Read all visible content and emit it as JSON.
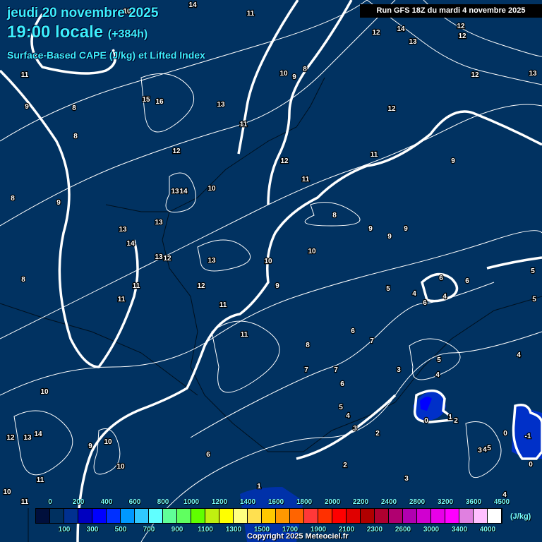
{
  "header": {
    "date": "jeudi 20 novembre 2025",
    "time": "19:00 locale",
    "offset": "(+384h)",
    "parameter": "Surface-Based CAPE (J/kg) et Lifted Index",
    "run": "Run GFS 18Z du mardi 4 novembre 2025"
  },
  "map": {
    "background_color": "#013261",
    "contour_labels": [
      "10",
      "14",
      "11",
      "12",
      "14",
      "12",
      "12",
      "13",
      "11",
      "10",
      "9",
      "8",
      "12",
      "13",
      "9",
      "8",
      "15",
      "16",
      "13",
      "12",
      "11",
      "8",
      "12",
      "12",
      "11",
      "9",
      "11",
      "10",
      "13",
      "14",
      "8",
      "9",
      "8",
      "13",
      "13",
      "9",
      "9",
      "9",
      "14",
      "10",
      "13",
      "12",
      "13",
      "10",
      "8",
      "6",
      "6",
      "5",
      "5",
      "4",
      "11",
      "12",
      "9",
      "4",
      "6",
      "5",
      "11",
      "11",
      "6",
      "11",
      "7",
      "8",
      "5",
      "4",
      "3",
      "7",
      "7",
      "4",
      "6",
      "10",
      "5",
      "4",
      "0",
      "1",
      "2",
      "2",
      "3",
      "12",
      "13",
      "14",
      "9",
      "10",
      "0",
      "-1",
      "6",
      "3",
      "4",
      "5",
      "10",
      "2",
      "0",
      "11",
      "3",
      "1",
      "10",
      "11",
      "4"
    ]
  },
  "legend": {
    "unit": "(J/kg)",
    "colors": [
      "#000f3c",
      "#003060",
      "#003090",
      "#0000c0",
      "#0000ff",
      "#0030ff",
      "#0098ff",
      "#30c8ff",
      "#60ffff",
      "#60ff98",
      "#60ff60",
      "#60ff00",
      "#c0f010",
      "#ffff00",
      "#ffff80",
      "#ffe050",
      "#ffc800",
      "#ff9800",
      "#ff6400",
      "#ff3838",
      "#ff3000",
      "#ff0000",
      "#e00000",
      "#b00000",
      "#b00030",
      "#b00070",
      "#b000b0",
      "#d000d0",
      "#e800e8",
      "#ff00ff",
      "#e080e0",
      "#ffc0ff",
      "#ffffff"
    ],
    "top_labels": [
      "0",
      "200",
      "400",
      "600",
      "800",
      "1000",
      "1200",
      "1400",
      "1600",
      "1800",
      "2000",
      "2200",
      "2400",
      "2800",
      "3200",
      "3600",
      "4500"
    ],
    "bottom_labels": [
      "100",
      "300",
      "500",
      "700",
      "900",
      "1100",
      "1300",
      "1500",
      "1700",
      "1900",
      "2100",
      "2300",
      "2600",
      "3000",
      "3400",
      "4000"
    ]
  },
  "copyright": "Copyright 2025 Meteociel.fr"
}
